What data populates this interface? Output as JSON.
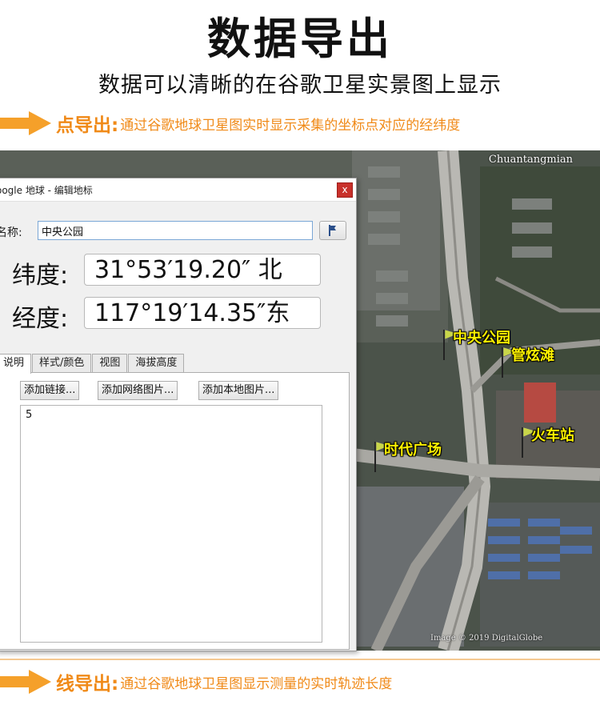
{
  "header": {
    "title": "数据导出",
    "subtitle": "数据可以清晰的在谷歌卫星实景图上显示"
  },
  "point_export": {
    "lead": "点导出:",
    "desc": "通过谷歌地球卫星图实时显示采集的坐标点对应的经纬度"
  },
  "line_export": {
    "lead": "线导出:",
    "desc": "通过谷歌地球卫星图显示测量的实时轨迹长度"
  },
  "map": {
    "top_label": "Chuantangmian",
    "copyright": "Image © 2019 DigitalGlobe",
    "pins": [
      {
        "label": "中央公园"
      },
      {
        "label": "管炫滩"
      },
      {
        "label": "时代广场"
      },
      {
        "label": "火车站"
      }
    ]
  },
  "dialog": {
    "title": "oogle 地球 - 编辑地标",
    "close": "x",
    "name_label": "名称:",
    "name_value": "中央公园",
    "latitude_label": "纬度:",
    "latitude_value": "31°53′19.20″ 北",
    "longitude_label": "经度:",
    "longitude_value": "117°19′14.35″东",
    "tabs": [
      "说明",
      "样式/颜色",
      "视图",
      "海拔高度"
    ],
    "buttons": [
      "添加链接...",
      "添加网络图片...",
      "添加本地图片..."
    ],
    "description": "5"
  },
  "colors": {
    "accent": "#f08a18",
    "pin_label": "#fbf000",
    "pin_flag": "#c9d64a"
  }
}
